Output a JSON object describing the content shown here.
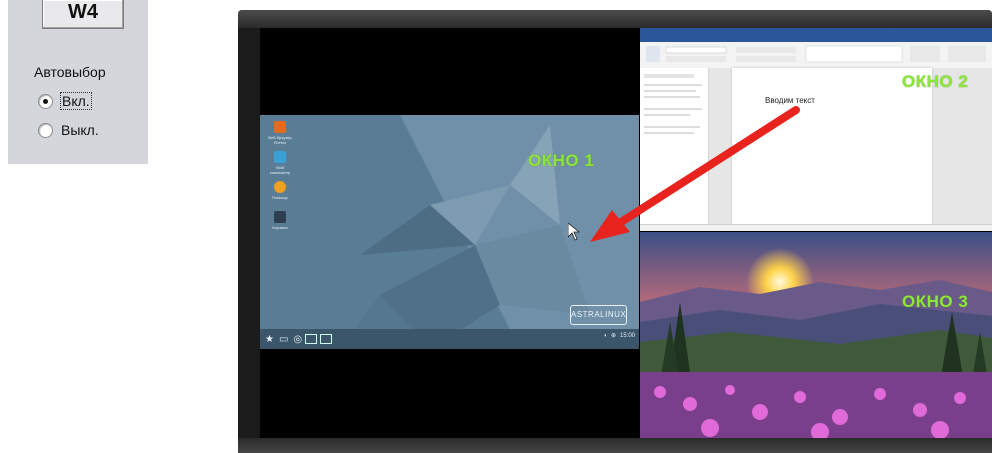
{
  "left_panel": {
    "button_label": "W4",
    "group_title": "Автовыбор",
    "options": [
      {
        "label": "Вкл.",
        "selected": true
      },
      {
        "label": "Выкл.",
        "selected": false
      }
    ]
  },
  "monitor": {
    "window1": {
      "label": "ОКНО 1",
      "logo": "ASTRALINUX",
      "tray_time": "15:00"
    },
    "window2": {
      "label": "ОКНО 2",
      "typed_text": "Вводим текст"
    },
    "window3": {
      "label": "ОКНО 3"
    }
  },
  "colors": {
    "label_green": "#8ee63a",
    "arrow_red": "#e8231e",
    "word_blue": "#2b579a",
    "astra_blue": "#5a7d96"
  }
}
